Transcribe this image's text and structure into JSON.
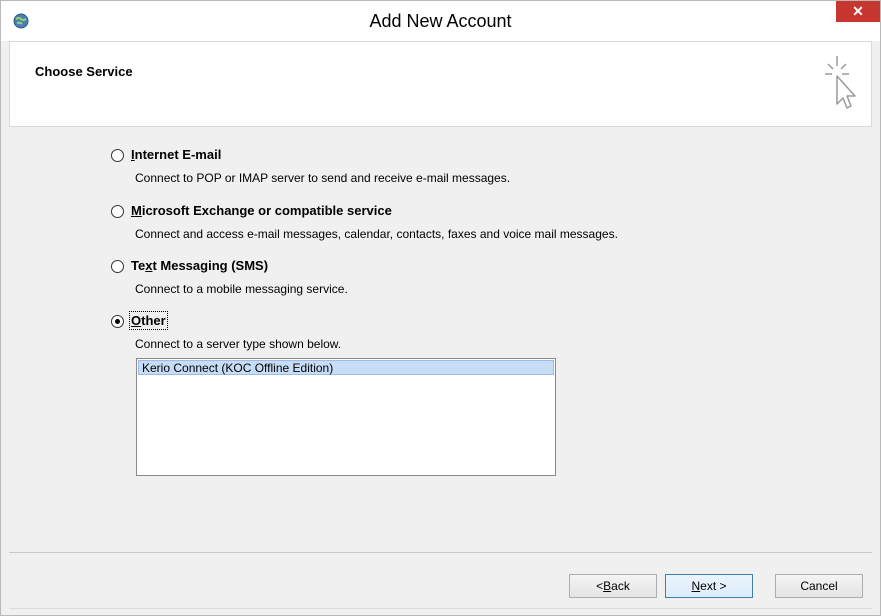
{
  "window": {
    "title": "Add New Account",
    "close_label": "✕"
  },
  "header": {
    "title": "Choose Service",
    "icon": "wizard-cursor-icon"
  },
  "options": [
    {
      "label_pre": "",
      "label_mnemonic": "I",
      "label_post": "nternet E-mail",
      "description": "Connect to POP or IMAP server to send and receive e-mail messages.",
      "checked": false
    },
    {
      "label_pre": "",
      "label_mnemonic": "M",
      "label_post": "icrosoft Exchange or compatible service",
      "description": "Connect and access e-mail messages, calendar, contacts, faxes and voice mail messages.",
      "checked": false
    },
    {
      "label_pre": "Te",
      "label_mnemonic": "x",
      "label_post": "t Messaging (SMS)",
      "description": "Connect to a mobile messaging service.",
      "checked": false
    },
    {
      "label_pre": "",
      "label_mnemonic": "O",
      "label_post": "ther",
      "description": "Connect to a server type shown below.",
      "checked": true
    }
  ],
  "server_list": {
    "items": [
      "Kerio Connect (KOC Offline Edition)"
    ],
    "selected_index": 0
  },
  "buttons": {
    "back_pre": "< ",
    "back_mnemonic": "B",
    "back_post": "ack",
    "next_mnemonic": "N",
    "next_post": "ext >",
    "cancel": "Cancel"
  }
}
